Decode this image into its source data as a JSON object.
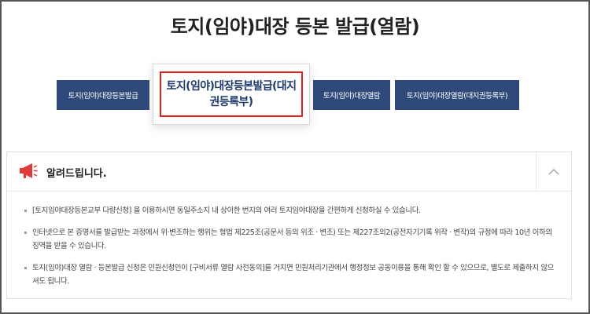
{
  "page": {
    "title": "토지(임야)대장 등본 발급(열람)"
  },
  "tabs": [
    {
      "label": "토지(임야)대장등본발급"
    },
    {
      "label": "토지(임야)대장등본발급(대지권등록부)",
      "active": true
    },
    {
      "label": "토지(임야)대장열람"
    },
    {
      "label": "토지(임야)대장열람(대지권등록부)"
    }
  ],
  "notice": {
    "icon": "megaphone-icon",
    "title": "알려드립니다.",
    "toggle_icon": "chevron-up-icon",
    "items": [
      "[토지임야대장등본교부 다량신청] 을 이용하시면 동일주소지 내 상이한 번지의 여러 토지임야대장을 간편하게 신청하실 수 있습니다.",
      "인터넷으로 본 증명서를 발급받는 과정에서 위·변조하는 행위는 형법 제225조(공문서 등의 위조 · 변조) 또는 제227조의2(공전자기기록 위작 · 변작)의 규정에 따라 10년 이하의 징역을 받을 수 있습니다.",
      "토지(임야)대장 열람 · 등본발급 신청은 민원신청인이 [구비서류 열람 사전동의]를 거치면 민원처리기관에서 행정정보 공동이용을 통해 확인 할 수 있으므로, 별도로 제출하지 않으셔도 됩니다."
    ]
  },
  "colors": {
    "tab_bg": "#2f4a7a",
    "active_tab_text": "#1f3a6b",
    "highlight_border": "#e02020",
    "megaphone": "#e03a3a"
  }
}
